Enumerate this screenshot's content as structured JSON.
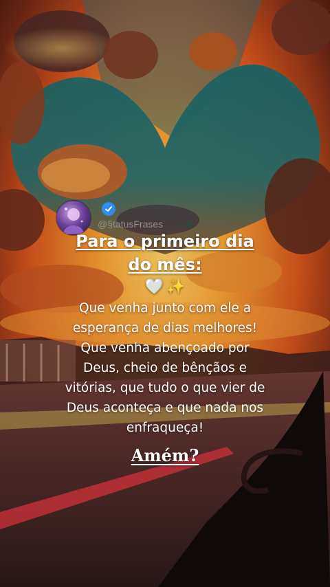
{
  "post": {
    "handle": "@§tatusFrases",
    "verified_icon": "verified-check-icon",
    "title_lines": [
      "Para o primeiro dia",
      "do mês:"
    ],
    "emoji": [
      "🤍",
      "✨"
    ],
    "body_lines": [
      "Que venha junto com ele a",
      "esperança de dias melhores!",
      "Que venha abençoado por",
      "Deus, cheio de bênçãos e",
      "vitórias, que tudo o que vier de",
      "Deus aconteça e que nada nos",
      "enfraqueça!"
    ],
    "closing": "Amém?"
  },
  "colors": {
    "sunset_orange": "#f28a1e",
    "sky_teal": "#1f5a5e",
    "verified_blue": "#2f8cf0"
  }
}
